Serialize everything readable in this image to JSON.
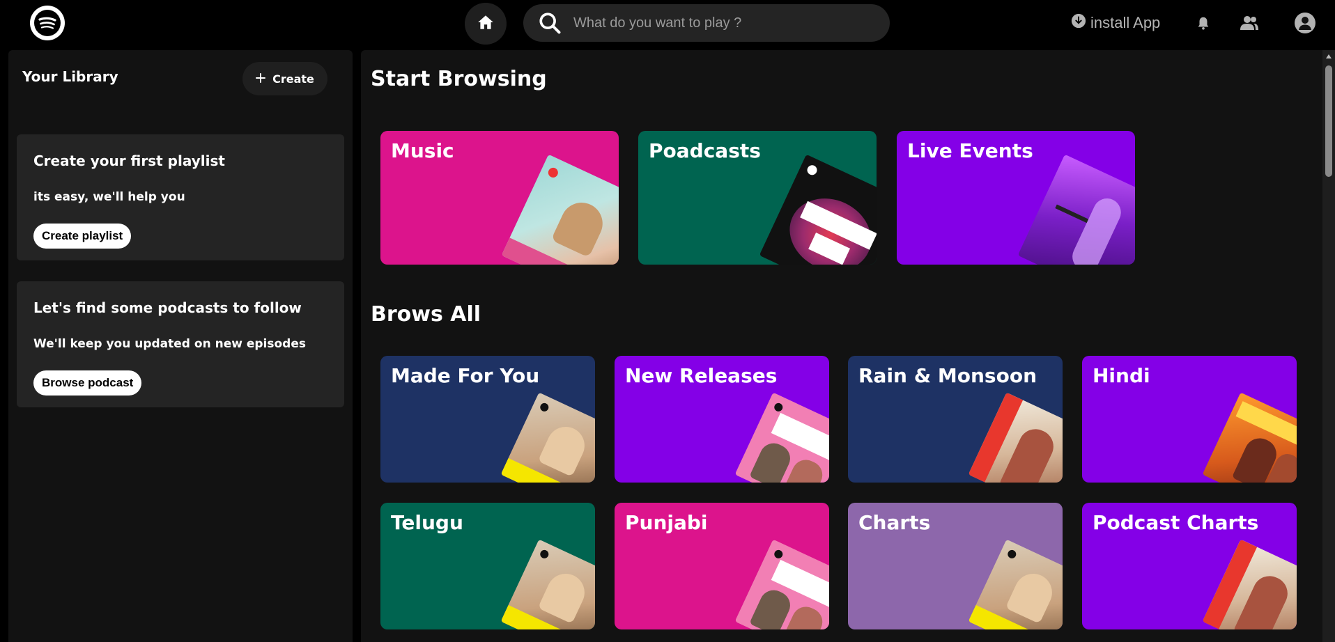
{
  "topbar": {
    "logo_icon": "spotify-logo",
    "home_icon": "home-icon",
    "search_icon": "search-icon",
    "search_placeholder": "What do you want to play ?",
    "install_label": "install App",
    "icons": [
      "bell-icon",
      "friends-icon",
      "user-avatar-icon"
    ]
  },
  "sidebar": {
    "title": "Your Library",
    "create_label": "Create",
    "cards": [
      {
        "title": "Create your first playlist",
        "subtitle": "its easy, we'll help you",
        "button": "Create playlist"
      },
      {
        "title": "Let's find some podcasts to follow",
        "subtitle": "We'll keep you updated on new episodes",
        "button": "Browse podcast"
      }
    ]
  },
  "main": {
    "start_title": "Start Browsing",
    "start_tiles": [
      {
        "label": "Music",
        "color": "#dc148c"
      },
      {
        "label": "Poadcasts",
        "color": "#006450"
      },
      {
        "label": "Live Events",
        "color": "#8400e7"
      }
    ],
    "browse_title": "Brows All",
    "browse_tiles": [
      {
        "label": "Made For You",
        "color": "#1e3264"
      },
      {
        "label": "New Releases",
        "color": "#8400e7"
      },
      {
        "label": "Rain & Monsoon",
        "color": "#1e3264"
      },
      {
        "label": "Hindi",
        "color": "#8400e7"
      },
      {
        "label": "Telugu",
        "color": "#006450"
      },
      {
        "label": "Punjabi",
        "color": "#dc148c"
      },
      {
        "label": "Charts",
        "color": "#8d67ab"
      },
      {
        "label": "Podcast Charts",
        "color": "#8400e7"
      }
    ]
  }
}
